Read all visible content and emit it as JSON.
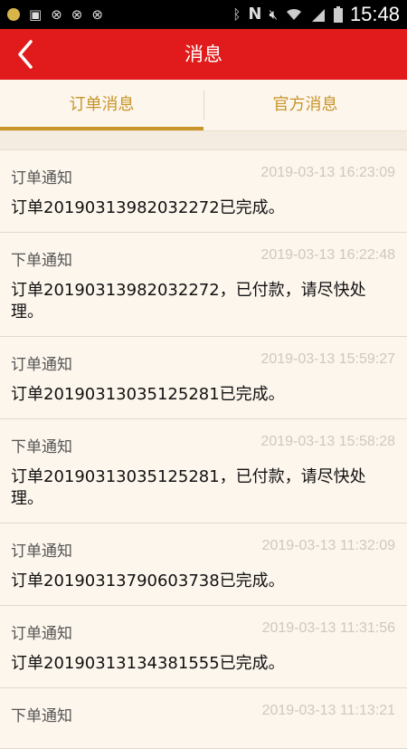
{
  "status_bar": {
    "time": "15:48",
    "icons": [
      "notification-dot-icon",
      "gallery-icon",
      "sync-icon",
      "sync-icon",
      "sync-icon",
      "bluetooth-icon",
      "nfc-icon",
      "mute-icon",
      "wifi-icon",
      "signal-icon",
      "battery-icon"
    ]
  },
  "header": {
    "title": "消息",
    "back_icon": "chevron-left-icon",
    "color": "#e11b1b"
  },
  "tabs": [
    {
      "label": "订单消息",
      "active": true
    },
    {
      "label": "官方消息",
      "active": false
    }
  ],
  "accent_color": "#c8952a",
  "messages": [
    {
      "title": "订单通知",
      "time": "2019-03-13 16:23:09",
      "body": "订单20190313982032272已完成。"
    },
    {
      "title": "下单通知",
      "time": "2019-03-13 16:22:48",
      "body": "订单20190313982032272，已付款，请尽快处理。"
    },
    {
      "title": "订单通知",
      "time": "2019-03-13 15:59:27",
      "body": "订单20190313035125281已完成。"
    },
    {
      "title": "下单通知",
      "time": "2019-03-13 15:58:28",
      "body": "订单20190313035125281，已付款，请尽快处理。"
    },
    {
      "title": "订单通知",
      "time": "2019-03-13 11:32:09",
      "body": "订单20190313790603738已完成。"
    },
    {
      "title": "订单通知",
      "time": "2019-03-13 11:31:56",
      "body": "订单20190313134381555已完成。"
    },
    {
      "title": "下单通知",
      "time": "2019-03-13 11:13:21",
      "body": ""
    }
  ]
}
